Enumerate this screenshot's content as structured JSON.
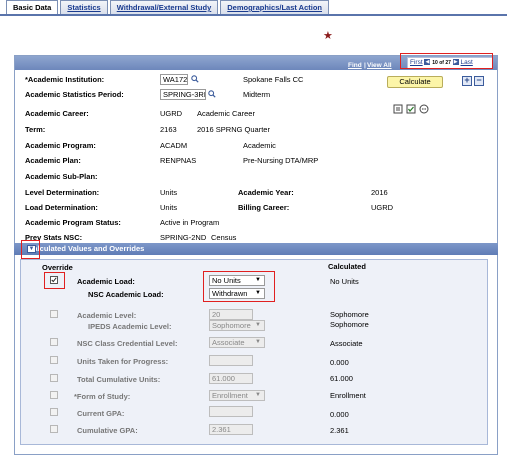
{
  "tabs": [
    "Basic Data",
    "Statistics",
    "Withdrawal/External Study",
    "Demographics/Last Action"
  ],
  "nav": {
    "find": "Find",
    "separator": "|",
    "view_all": "View All",
    "first": "First",
    "count": "10 of 27",
    "last": "Last"
  },
  "basic": {
    "institution_label": "*Academic Institution:",
    "institution_value": "WA172",
    "institution_desc": "Spokane Falls CC",
    "period_label": "Academic Statistics Period:",
    "period_value": "SPRING-3RD",
    "period_desc": "Midterm",
    "calculate_label": "Calculate",
    "career_label": "Academic Career:",
    "career_value": "UGRD",
    "career_desc": "Academic Career",
    "term_label": "Term:",
    "term_value": "2163",
    "term_desc": "2016 SPRNG Quarter",
    "program_label": "Academic Program:",
    "program_value": "ACADM",
    "program_desc": "Academic",
    "plan_label": "Academic Plan:",
    "plan_value": "RENPNAS",
    "plan_desc": "Pre-Nursing DTA/MRP",
    "subplan_label": "Academic Sub-Plan:",
    "level_det_label": "Level Determination:",
    "level_det_value": "Units",
    "acad_year_label": "Academic Year:",
    "acad_year_value": "2016",
    "load_det_label": "Load Determination:",
    "load_det_value": "Units",
    "billing_label": "Billing Career:",
    "billing_value": "UGRD",
    "prog_status_label": "Academic Program Status:",
    "prog_status_value": "Active in Program",
    "prev_nsc_label": "Prev Stats NSC:",
    "prev_nsc_value": "SPRING-2ND",
    "prev_nsc_desc": "Census"
  },
  "calc": {
    "title": "Calculated Values and Overrides",
    "override_header": "Override",
    "calculated_header": "Calculated",
    "academic_load_label": "Academic Load:",
    "academic_load_select": "No Units",
    "academic_load_calc": "No Units",
    "nsc_load_label": "NSC Academic Load:",
    "nsc_load_select": "Withdrawn",
    "academic_level_label": "Academic Level:",
    "academic_level_value": "20",
    "academic_level_calc": "Sophomore",
    "ipeds_label": "IPEDS Academic Level:",
    "ipeds_value": "Sophomore",
    "ipeds_calc": "Sophomore",
    "nsc_class_label": "NSC Class Credential Level:",
    "nsc_class_value": "Associate",
    "nsc_class_calc": "Associate",
    "units_progress_label": "Units Taken for Progress:",
    "units_progress_calc": "0.000",
    "total_units_label": "Total Cumulative Units:",
    "total_units_value": "61.000",
    "total_units_calc": "61.000",
    "form_study_label": "*Form of Study:",
    "form_study_value": "Enrollment",
    "form_study_calc": "Enrollment",
    "current_gpa_label": "Current GPA:",
    "current_gpa_calc": "0.000",
    "cum_gpa_label": "Cumulative GPA:",
    "cum_gpa_value": "2.361",
    "cum_gpa_calc": "2.361"
  }
}
